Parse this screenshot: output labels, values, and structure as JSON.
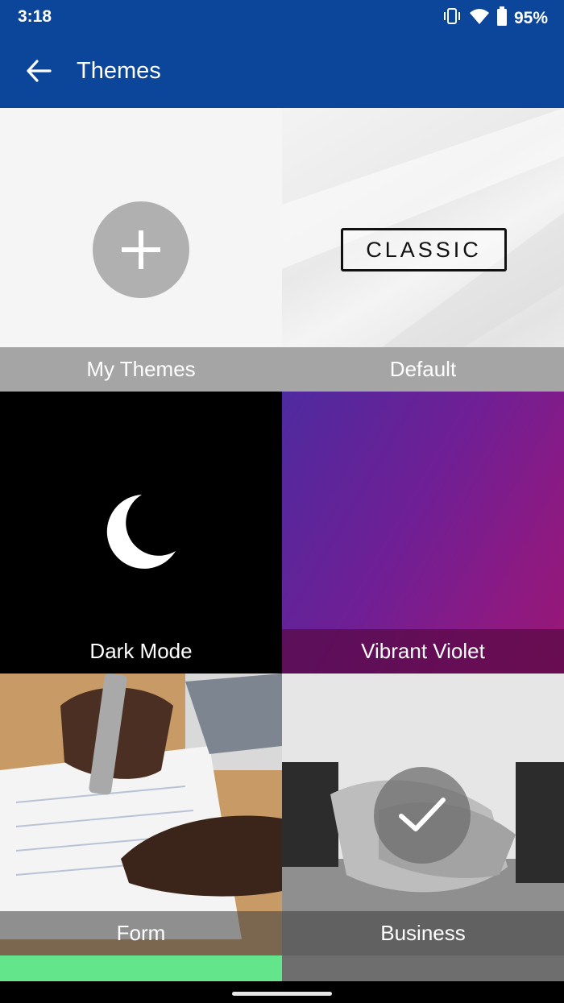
{
  "status_bar": {
    "time": "3:18",
    "battery": "95%",
    "icons": [
      "vibrate-icon",
      "wifi-icon",
      "battery-icon"
    ]
  },
  "app_bar": {
    "title": "Themes",
    "back_icon": "arrow-left-icon"
  },
  "themes": [
    {
      "label": "My Themes",
      "icon": "plus-icon"
    },
    {
      "label": "Default",
      "badge": "CLASSIC"
    },
    {
      "label": "Dark Mode",
      "icon": "moon-icon"
    },
    {
      "label": "Vibrant Violet"
    },
    {
      "label": "Form"
    },
    {
      "label": "Business",
      "selected": true,
      "icon": "check-icon"
    }
  ],
  "colors": {
    "primary": "#0b469a",
    "accent_strip": "#62e58b"
  }
}
